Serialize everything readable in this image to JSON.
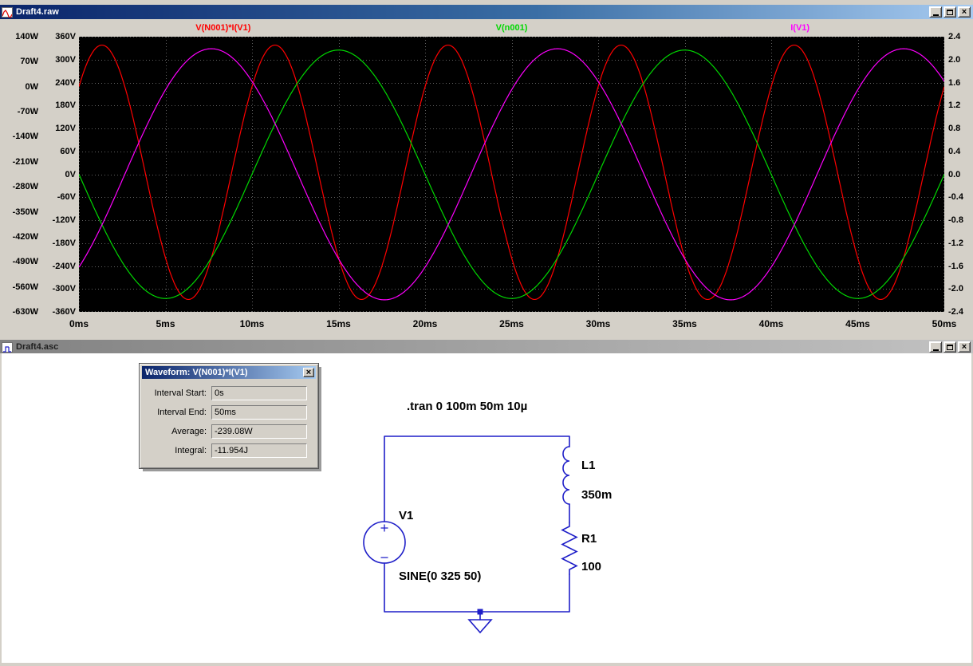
{
  "icons": {
    "close_glyph": "×"
  },
  "raw_window": {
    "title": "Draft4.raw",
    "plot": {
      "bg_color": "#000000",
      "grid_color": "#606060",
      "x_axis": {
        "labels": [
          "0ms",
          "5ms",
          "10ms",
          "15ms",
          "20ms",
          "25ms",
          "30ms",
          "35ms",
          "40ms",
          "45ms",
          "50ms"
        ],
        "min": 0,
        "max": 50
      },
      "axes": {
        "W": {
          "labels": [
            "140W",
            "70W",
            "0W",
            "-70W",
            "-140W",
            "-210W",
            "-280W",
            "-350W",
            "-420W",
            "-490W",
            "-560W",
            "-630W"
          ],
          "max": 140,
          "min": -630
        },
        "V": {
          "labels": [
            "360V",
            "300V",
            "240V",
            "180V",
            "120V",
            "60V",
            "0V",
            "-60V",
            "-120V",
            "-180V",
            "-240V",
            "-300V",
            "-360V"
          ],
          "max": 360,
          "min": -360
        },
        "I": {
          "labels": [
            "2.4",
            "2.0",
            "1.6",
            "1.2",
            "0.8",
            "0.4",
            "0.0",
            "-0.4",
            "-0.8",
            "-1.2",
            "-1.6",
            "-2.0",
            "-2.4"
          ],
          "max": 2.4,
          "min": -2.4
        }
      },
      "traces": [
        {
          "name": "V(N001)*I(V1)",
          "color": "#ff0000",
          "axis": "W",
          "offset": -239.4,
          "amp": 355.9,
          "period_ms": 10,
          "phase_deg": 42.3
        },
        {
          "name": "V(n001)",
          "color": "#00d800",
          "axis": "V",
          "offset": 0,
          "amp": 325,
          "period_ms": 20,
          "phase_deg": 180
        },
        {
          "name": "I(V1)",
          "color": "#ff00ff",
          "axis": "I",
          "offset": 0,
          "amp": 2.19,
          "period_ms": 20,
          "phase_deg": -47.7
        }
      ]
    }
  },
  "asc_window": {
    "title": "Draft4.asc",
    "dialog": {
      "title": "Waveform: V(N001)*I(V1)",
      "fields": [
        {
          "label": "Interval Start:",
          "value": "0s"
        },
        {
          "label": "Interval End:",
          "value": "50ms"
        },
        {
          "label": "Average:",
          "value": "-239.08W"
        },
        {
          "label": "Integral:",
          "value": "-11.954J"
        }
      ]
    },
    "directive": ".tran 0 100m 50m 10µ",
    "schematic": {
      "wire_color": "#1e1ec8",
      "source_name": "V1",
      "source_value": "SINE(0 325 50)",
      "inductor_name": "L1",
      "inductor_value": "350m",
      "resistor_name": "R1",
      "resistor_value": "100"
    }
  }
}
